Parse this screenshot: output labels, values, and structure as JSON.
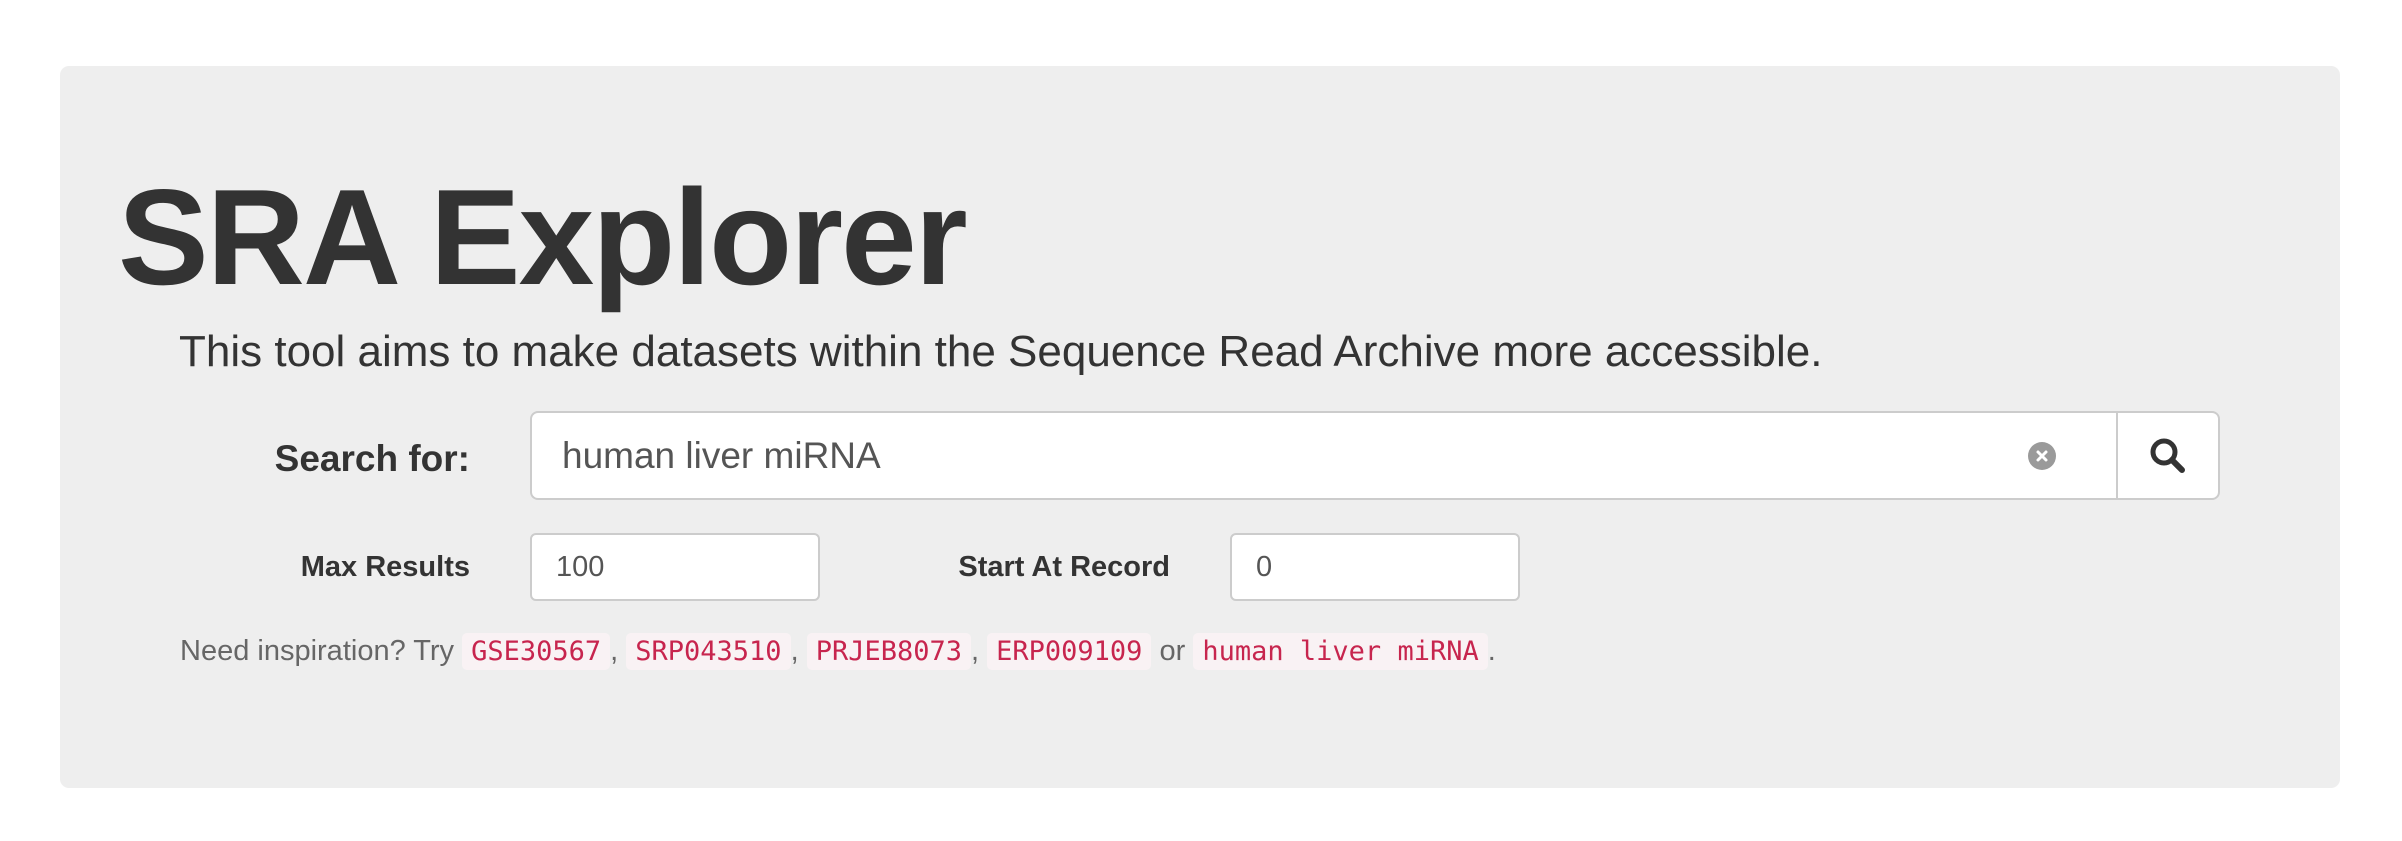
{
  "header": {
    "title": "SRA Explorer",
    "lead": "This tool aims to make datasets within the Sequence Read Archive more accessible."
  },
  "search": {
    "label": "Search for:",
    "value": "human liver miRNA",
    "clear_icon": "clear-circle-icon",
    "button_icon": "search-icon"
  },
  "options": {
    "max_results_label": "Max Results",
    "max_results_value": "100",
    "start_at_label": "Start At Record",
    "start_at_value": "0"
  },
  "inspiration": {
    "prefix": "Need inspiration? Try",
    "examples": [
      "GSE30567",
      "SRP043510",
      "PRJEB8073",
      "ERP009109",
      "human liver miRNA"
    ],
    "comma": ",",
    "or_text": "or",
    "period": "."
  },
  "colors": {
    "jumbotron_bg": "#eeeeee",
    "code_text": "#c7254e",
    "code_bg": "#f9f2f4"
  }
}
